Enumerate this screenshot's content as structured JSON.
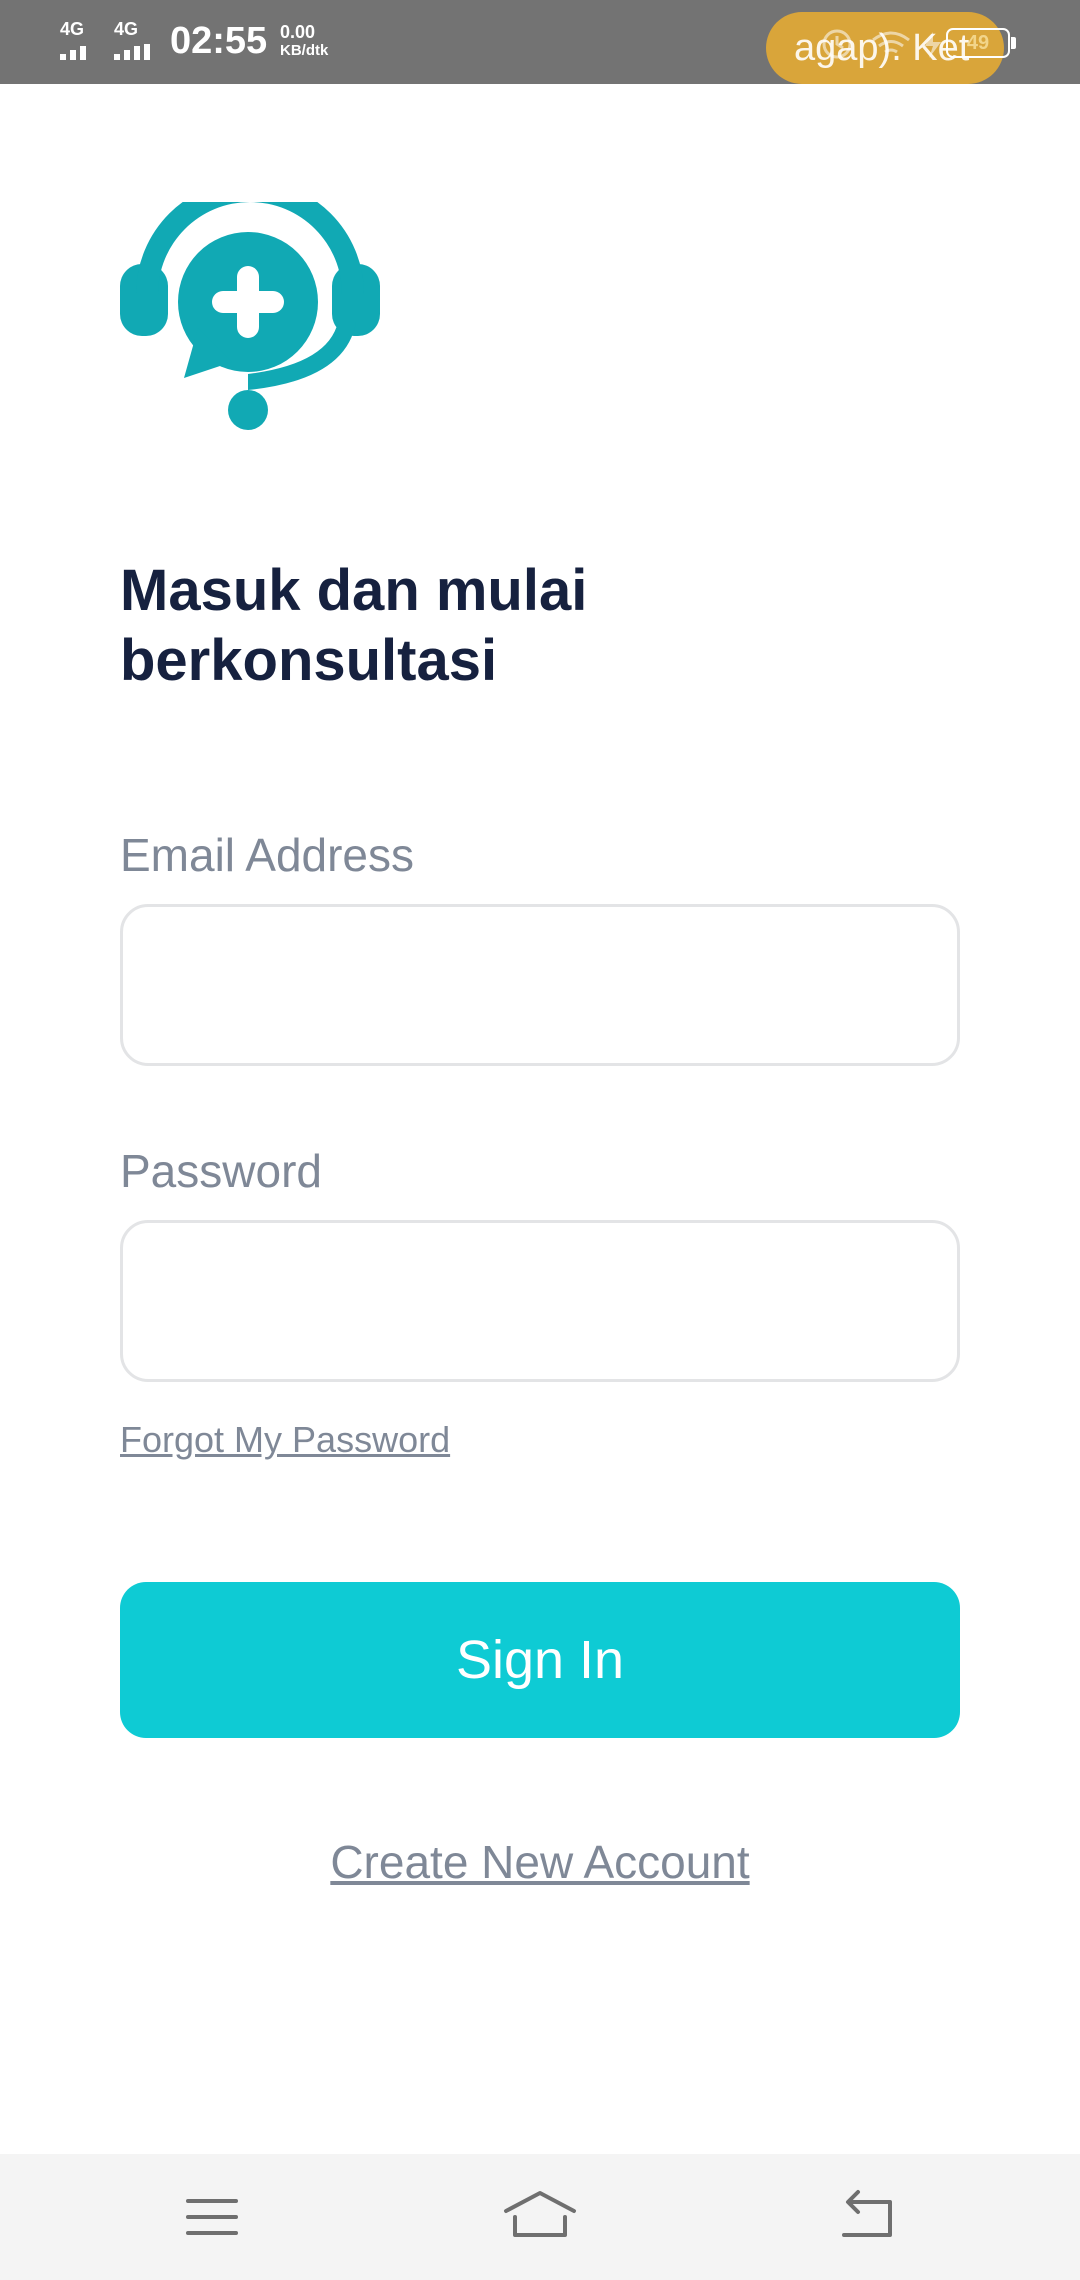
{
  "status_bar": {
    "network_1": "4G",
    "network_2": "4G",
    "time": "02:55",
    "speed_value": "0.00",
    "speed_unit": "KB/dtk",
    "notification_ticker": "agap). Ket",
    "battery_level": "49",
    "pill_color": "#d9a53a"
  },
  "brand": {
    "logo_icon": "chat-headset-plus-icon",
    "accent_color": "#11a9b4"
  },
  "headline": {
    "line1": "Masuk dan mulai",
    "line2": "berkonsultasi"
  },
  "form": {
    "email_label": "Email Address",
    "email_value": "",
    "password_label": "Password",
    "password_value": "",
    "forgot_link": "Forgot My Password",
    "submit_label": "Sign In",
    "submit_color": "#0ecbd4"
  },
  "footer": {
    "create_account_link": "Create New Account"
  },
  "nav_bar": {
    "menu_icon": "menu-icon",
    "home_icon": "home-icon",
    "back_icon": "back-icon"
  }
}
